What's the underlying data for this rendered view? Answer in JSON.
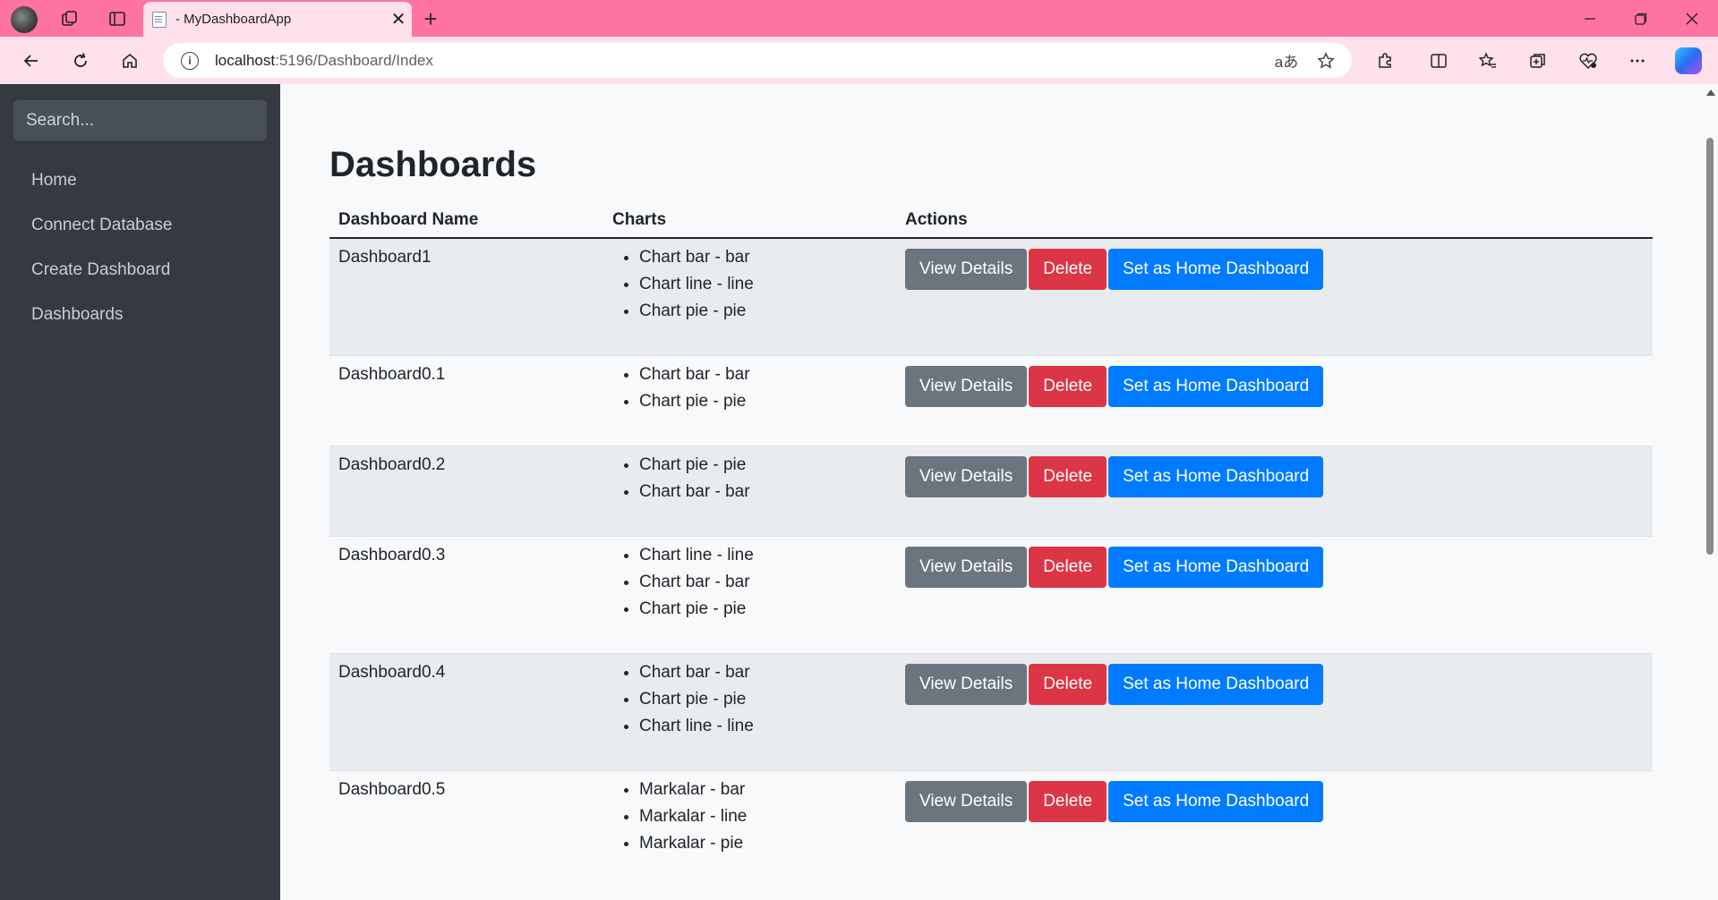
{
  "browser": {
    "tab_title": " - MyDashboardApp",
    "tab_close": "✕",
    "new_tab": "+",
    "url_host": "localhost",
    "url_rest": ":5196/Dashboard/Index",
    "read_aloud_icon": "aあ",
    "accent_color": "#ff73a0"
  },
  "sidebar": {
    "search_placeholder": "Search...",
    "items": [
      {
        "label": "Home"
      },
      {
        "label": "Connect Database"
      },
      {
        "label": "Create Dashboard"
      },
      {
        "label": "Dashboards"
      }
    ]
  },
  "main": {
    "title": "Dashboards",
    "columns": [
      "Dashboard Name",
      "Charts",
      "Actions"
    ],
    "button_labels": {
      "view": "View Details",
      "delete": "Delete",
      "home": "Set as Home Dashboard"
    },
    "rows": [
      {
        "name": "Dashboard1",
        "charts": [
          "Chart bar - bar",
          "Chart line - line",
          "Chart pie - pie"
        ]
      },
      {
        "name": "Dashboard0.1",
        "charts": [
          "Chart bar - bar",
          "Chart pie - pie"
        ]
      },
      {
        "name": "Dashboard0.2",
        "charts": [
          "Chart pie - pie",
          "Chart bar - bar"
        ]
      },
      {
        "name": "Dashboard0.3",
        "charts": [
          "Chart line - line",
          "Chart bar - bar",
          "Chart pie - pie"
        ]
      },
      {
        "name": "Dashboard0.4",
        "charts": [
          "Chart bar - bar",
          "Chart pie - pie",
          "Chart line - line"
        ]
      },
      {
        "name": "Dashboard0.5",
        "charts": [
          "Markalar - bar",
          "Markalar - line",
          "Markalar - pie"
        ]
      }
    ]
  }
}
